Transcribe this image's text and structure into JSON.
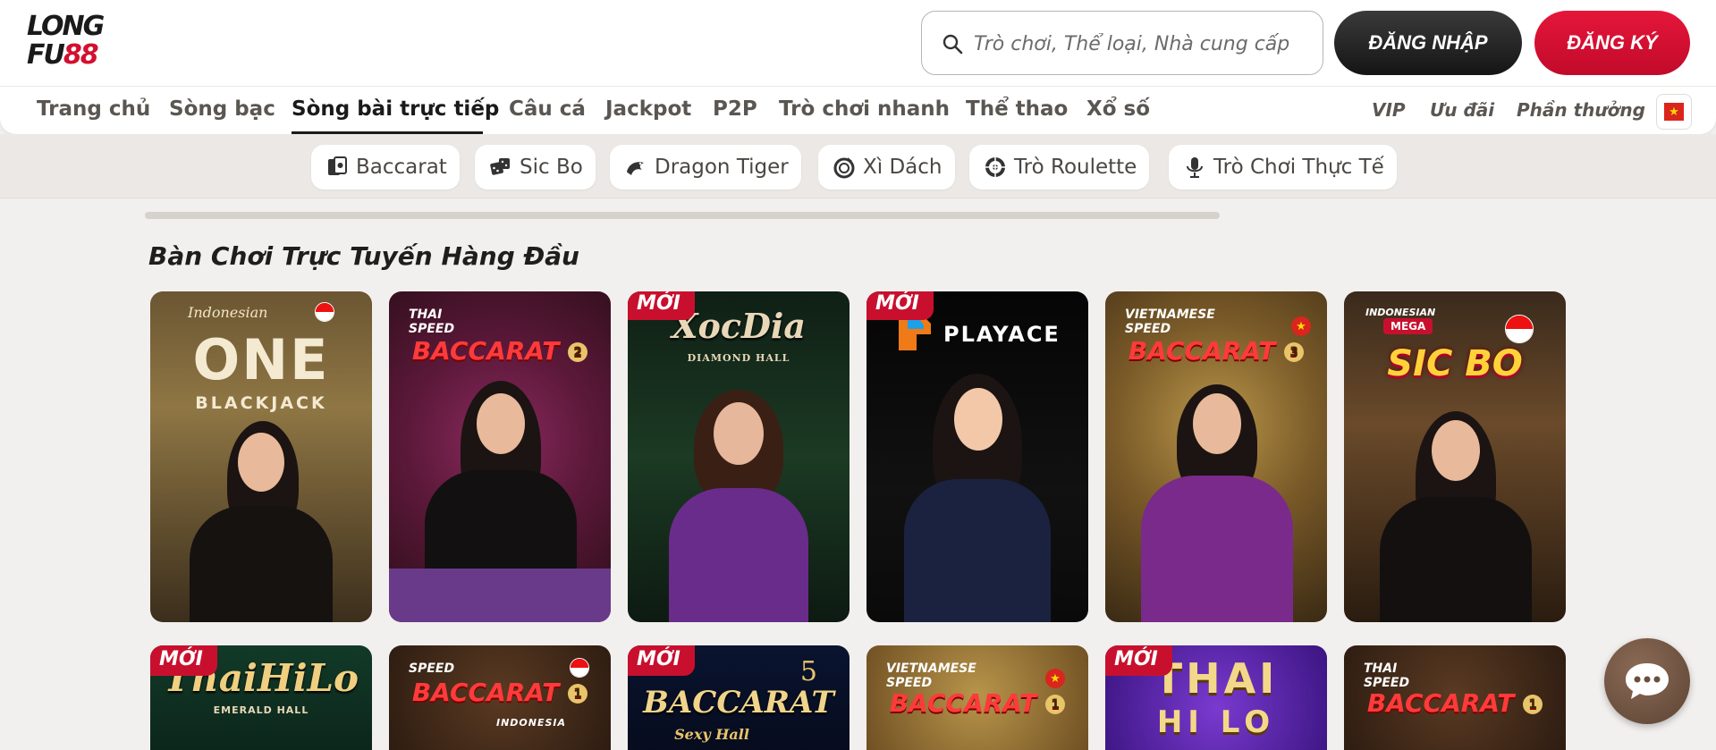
{
  "logo": {
    "line1": "LONG",
    "line2_a": "FU",
    "line2_b": "88"
  },
  "search": {
    "placeholder": "Trò chơi, Thể loại, Nhà cung cấp"
  },
  "auth": {
    "login_label": "ĐĂNG NHẬP",
    "register_label": "ĐĂNG KÝ"
  },
  "nav": {
    "items": [
      {
        "label": "Trang chủ"
      },
      {
        "label": "Sòng bạc"
      },
      {
        "label": "Sòng bài trực tiếp"
      },
      {
        "label": "Câu cá"
      },
      {
        "label": "Jackpot"
      },
      {
        "label": "P2P"
      },
      {
        "label": "Trò chơi nhanh"
      },
      {
        "label": "Thể thao"
      },
      {
        "label": "Xổ số"
      }
    ],
    "active_index": 2,
    "right_items": [
      {
        "label": "VIP"
      },
      {
        "label": "Ưu đãi"
      },
      {
        "label": "Phần thưởng"
      }
    ],
    "flag_star": "★"
  },
  "categories": [
    {
      "label": "Baccarat",
      "icon": "cards-icon"
    },
    {
      "label": "Sic Bo",
      "icon": "dice-icon"
    },
    {
      "label": "Dragon Tiger",
      "icon": "dragon-icon"
    },
    {
      "label": "Xì Dách",
      "icon": "poker-chip-icon"
    },
    {
      "label": "Trò Roulette",
      "icon": "roulette-icon"
    },
    {
      "label": "Trò Chơi Thực Tế",
      "icon": "microphone-icon"
    }
  ],
  "section": {
    "title": "Bàn Chơi Trực Tuyến Hàng Đầu"
  },
  "badge_new": "MỚI",
  "cards_row1": [
    {
      "pre": "Indonesian",
      "title": "ONE",
      "sub": "BLACKJACK"
    },
    {
      "pre": "THAI SPEED",
      "title": "BACCARAT",
      "num": "2"
    },
    {
      "title": "XocDia",
      "sub": "DIAMOND HALL"
    },
    {
      "title": "PLAYACE"
    },
    {
      "pre": "VIETNAMESE SPEED",
      "title": "BACCARAT",
      "num": "3"
    },
    {
      "pre": "INDONESIAN",
      "pre2": "MEGA",
      "title": "SIC BO"
    }
  ],
  "cards_row2": [
    {
      "title": "ThaiHiLo",
      "sub": "EMERALD HALL"
    },
    {
      "pre": "SPEED",
      "title": "BACCARAT",
      "num": "1",
      "sub": "INDONESIA"
    },
    {
      "title": "BACCARAT",
      "num": "5",
      "sub": "Sexy Hall"
    },
    {
      "pre": "VIETNAMESE SPEED",
      "title": "BACCARAT",
      "num": "1"
    },
    {
      "title": "THAI",
      "title2": "HI LO"
    },
    {
      "pre": "THAI SPEED",
      "title": "BACCARAT",
      "num": "1"
    }
  ],
  "colors": {
    "brand_red": "#c8102e",
    "dark": "#1a1a1a",
    "gold": "#e8c46a"
  }
}
